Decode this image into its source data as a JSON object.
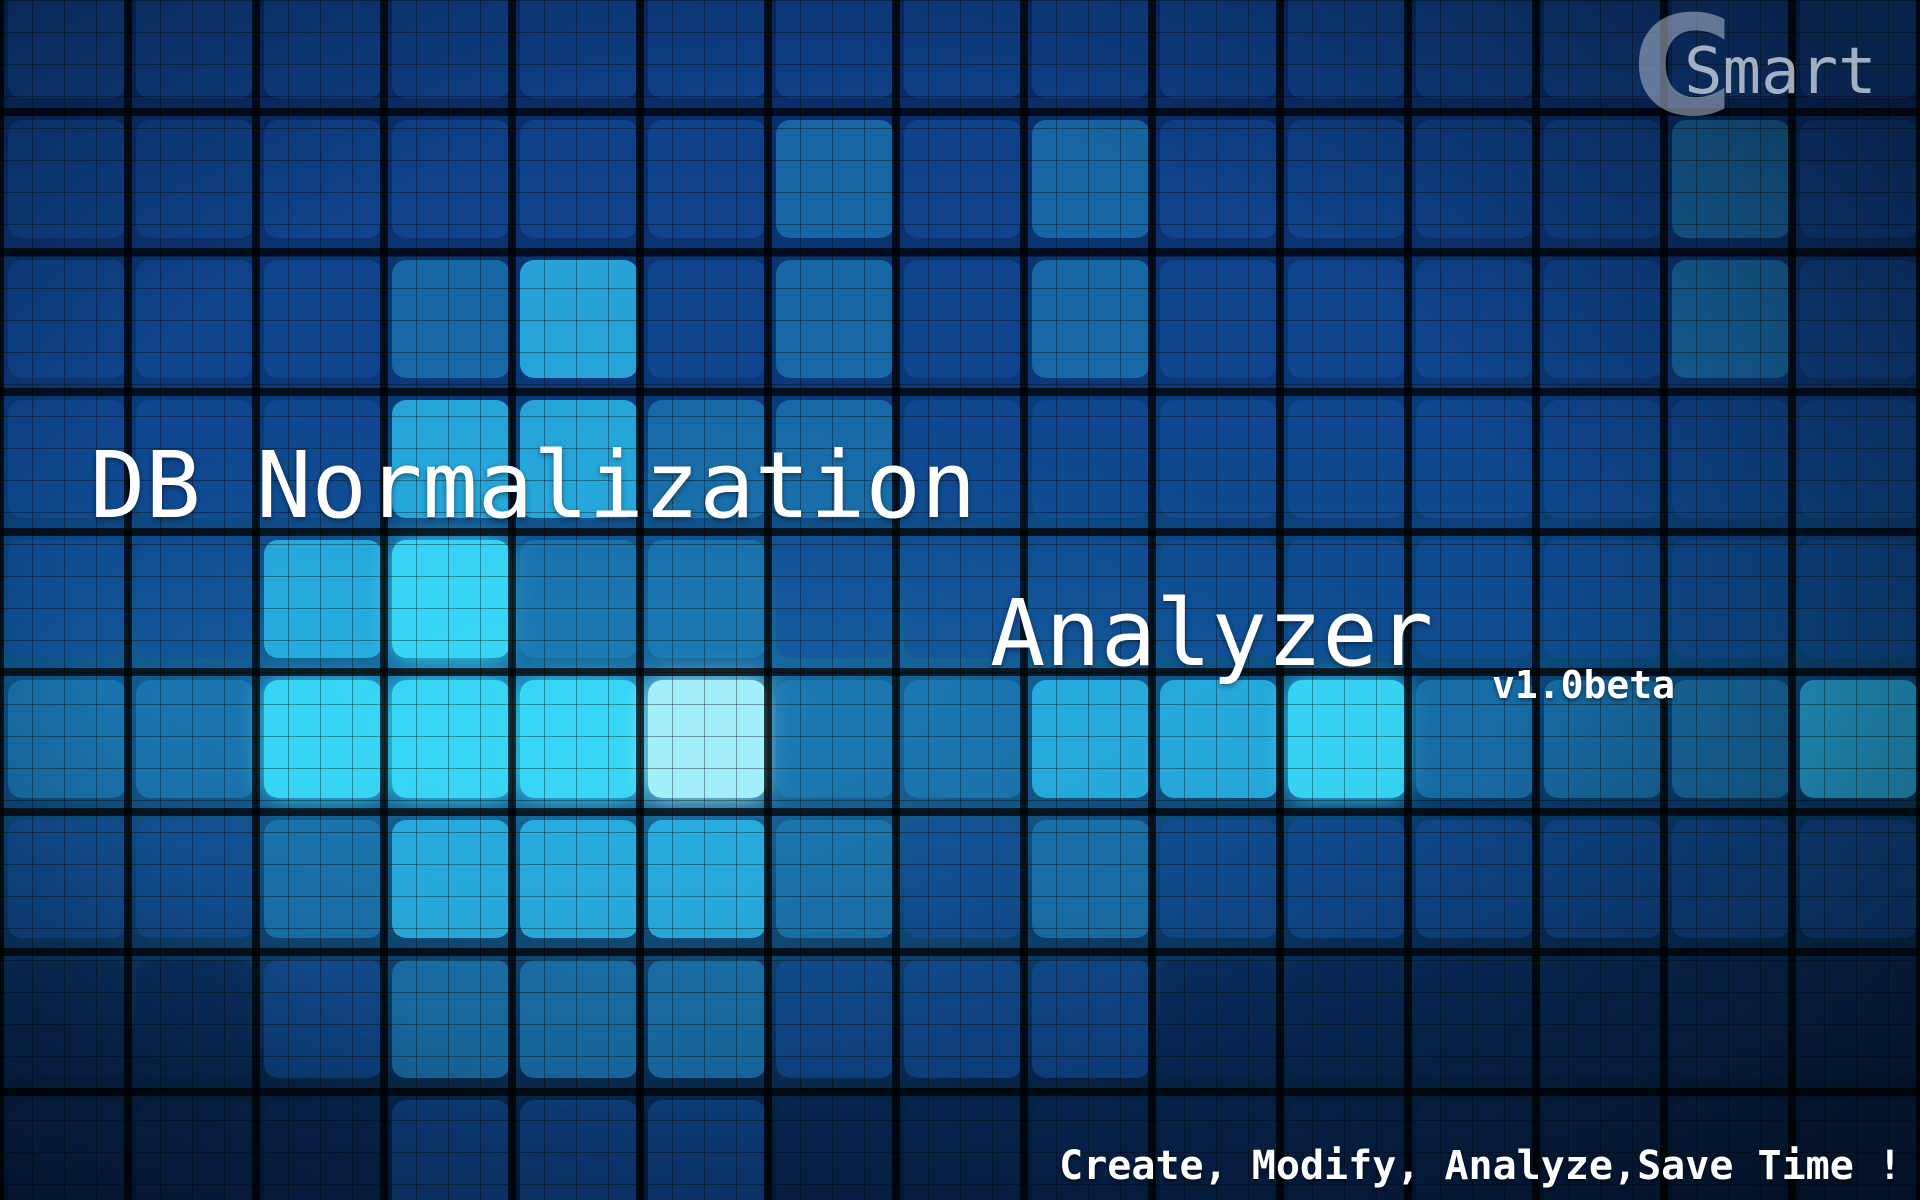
{
  "splash": {
    "logo": {
      "mark": "C",
      "text": "Smart"
    },
    "title_line1": "DB Normalization",
    "title_line2": "Analyzer",
    "version": "v1.0beta",
    "tagline": "Create, Modify, Analyze,Save Time !"
  },
  "colors": {
    "background_dark": "#061a3c",
    "tile_blue": "#1f66b8",
    "tile_cyan": "#36d6ff",
    "tile_bright": "#a6f4ff",
    "title_text": "#ffffff",
    "logo_gray": "#bec8d7"
  }
}
